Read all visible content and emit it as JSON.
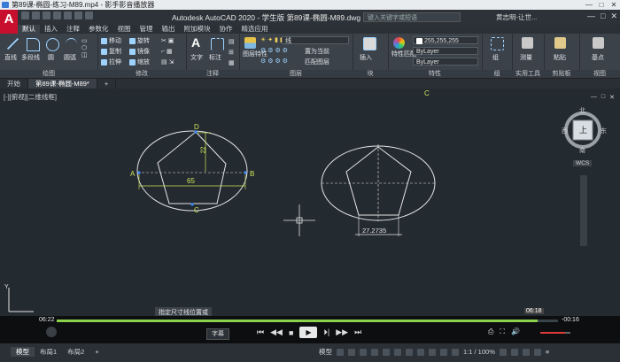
{
  "player": {
    "title": "第89课-椭圆-练习-M89.mp4 - 影手影音播放器",
    "controls": [
      "—",
      "□",
      "✕"
    ]
  },
  "cad": {
    "title": "Autodesk AutoCAD 2020 - 学生版    第89课-椭圆-M89.dwg",
    "search_placeholder": "键入关键字或短语",
    "user": "黄志明-让世...",
    "window_controls": [
      "—",
      "□",
      "✕"
    ]
  },
  "ribbon_tabs": [
    "默认",
    "插入",
    "注释",
    "参数化",
    "视图",
    "管理",
    "输出",
    "附加模块",
    "协作",
    "精选应用"
  ],
  "ribbon": {
    "draw": {
      "label": "绘图",
      "buttons": [
        "直线",
        "多段线",
        "圆",
        "圆弧"
      ]
    },
    "modify": {
      "label": "修改",
      "buttons": [
        "移动",
        "旋转",
        "复制",
        "镜像",
        "拉伸",
        "缩放"
      ]
    },
    "annotation": {
      "label": "注释",
      "buttons": [
        "文字",
        "标注"
      ]
    },
    "layers": {
      "label": "图层",
      "props": "图层特性",
      "current_layer": "线",
      "set_current": "置为当前",
      "match": "匹配图层"
    },
    "block": {
      "label": "块",
      "insert": "插入"
    },
    "properties": {
      "label": "特性",
      "match": "特性匹配",
      "color": "255,255,255",
      "linetype": "ByLayer",
      "lineweight": "ByLayer"
    },
    "groups": {
      "label": "组",
      "group": "组"
    },
    "utilities": {
      "label": "实用工具",
      "measure": "测量"
    },
    "clipboard": {
      "label": "剪贴板",
      "paste": "粘贴"
    },
    "view": {
      "label": "视图",
      "base": "基点"
    }
  },
  "doc_tabs": [
    "开始",
    "第89课-椭圆-M89*"
  ],
  "viewport_label": "[-][俯视][二维线框]",
  "viewcube": {
    "top": "上",
    "n": "北",
    "s": "南",
    "w": "西",
    "e": "东",
    "wcs": "WCS"
  },
  "drawing": {
    "point_labels": {
      "A": "A",
      "B": "B",
      "C": "C",
      "D": "D",
      "top_c": "C"
    },
    "dim_width": "65",
    "dim_height": "22",
    "dim_base": "27.2735"
  },
  "caption": "指定尺寸线位置或",
  "video": {
    "time_current_left": "06:22",
    "time_remaining": "-00:16",
    "time_marker": "06:18",
    "subtitle_button": "字幕",
    "progress": 0.96
  },
  "layout_tabs": [
    "模型",
    "布局1",
    "布局2",
    "+"
  ],
  "status": {
    "model": "模型",
    "scale": "1:1 / 100%"
  },
  "colors": {
    "accent": "#c8102e",
    "progress": "#8cd14a",
    "geometry": "#e6e6e6",
    "dim": "#cfe85a"
  }
}
